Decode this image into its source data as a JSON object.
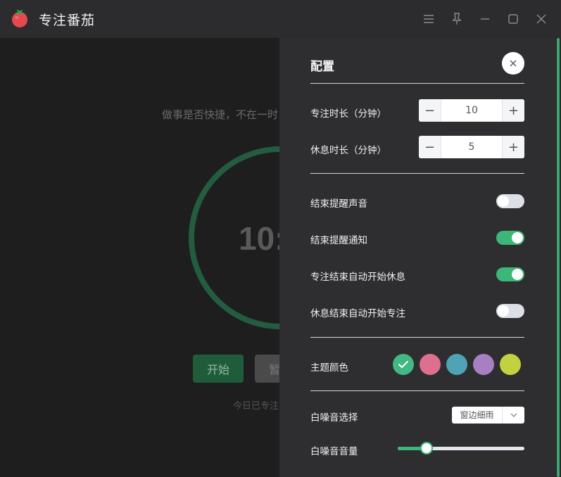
{
  "app": {
    "title": "专注番茄",
    "logo_icon": "tomato-icon"
  },
  "titlebar": {
    "icons": [
      "menu-icon",
      "pin-icon",
      "minimize-icon",
      "maximize-icon",
      "close-icon"
    ]
  },
  "timer_view": {
    "quote": "做事是否快捷，不在一时",
    "time_display": "10:",
    "start_label": "开始",
    "pause_label": "暂",
    "today_text": "今日已专注"
  },
  "config": {
    "title": "配置",
    "focus_duration": {
      "label": "专注时长（分钟）",
      "value": "10"
    },
    "rest_duration": {
      "label": "休息时长（分钟）",
      "value": "5"
    },
    "toggles": [
      {
        "label": "结束提醒声音",
        "on": false
      },
      {
        "label": "结束提醒通知",
        "on": true
      },
      {
        "label": "专注结束自动开始休息",
        "on": true
      },
      {
        "label": "休息结束自动开始专注",
        "on": false
      }
    ],
    "theme": {
      "label": "主题颜色",
      "colors": [
        "#42b883",
        "#dd6f8f",
        "#4fa3b4",
        "#a87fc2",
        "#c2d13f"
      ],
      "selected_index": 0
    },
    "white_noise": {
      "label": "白噪音选择",
      "selected": "窗边细雨"
    },
    "volume": {
      "label": "白噪音音量",
      "level": 0.2
    }
  },
  "colors": {
    "accent": "#3db67a",
    "ring": "#2a7a52"
  }
}
